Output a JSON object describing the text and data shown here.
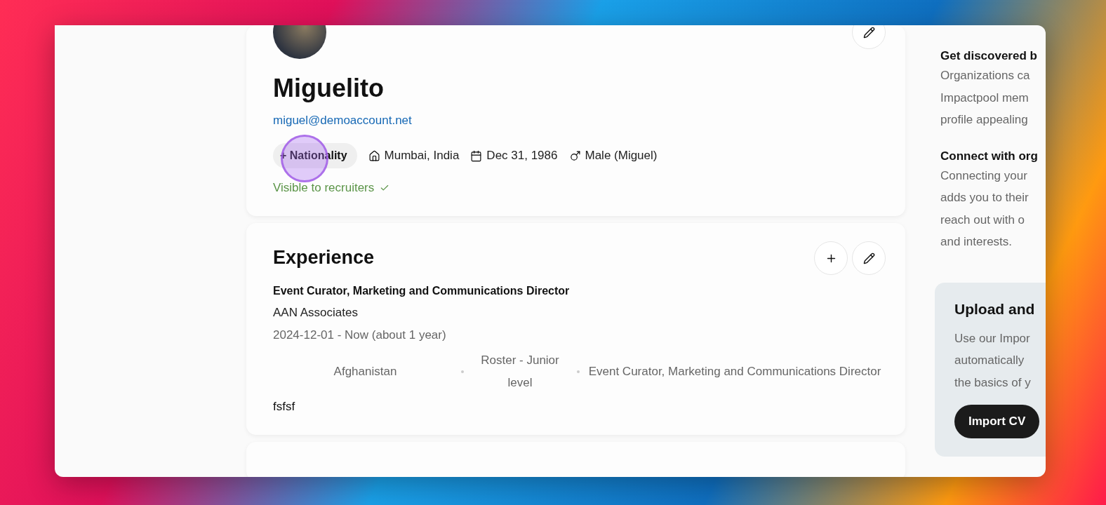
{
  "profile": {
    "name": "Miguelito",
    "email": "miguel@demoaccount.net",
    "nationality_button": "+ Nationality",
    "details": [
      {
        "kind": "location",
        "text": "Mumbai, India"
      },
      {
        "kind": "birthday",
        "text": "Dec 31, 1986"
      },
      {
        "kind": "gender",
        "text": "Male (Miguel)"
      }
    ],
    "visibility": {
      "text": "Visible to recruiters",
      "checked": true
    }
  },
  "experience": {
    "title": "Experience",
    "entries": [
      {
        "position": "Event Curator, Marketing and Communications Director",
        "organization": "AAN Associates",
        "dates": "2024-12-01 - Now (about 1 year)",
        "meta": [
          "Afghanistan",
          "Roster - Junior level",
          "Event Curator, Marketing and Communications Director"
        ],
        "description": "fsfsf"
      }
    ]
  },
  "sidebar": {
    "sections": [
      {
        "title": "Get discovered b",
        "lines": [
          "Organizations ca",
          "Impactpool mem",
          "profile appealing"
        ]
      },
      {
        "title": "Connect with org",
        "lines": [
          "Connecting your",
          "adds you to their",
          "reach out with o",
          "and interests."
        ]
      }
    ],
    "upload": {
      "title": "Upload and",
      "lines": [
        "Use our Impor",
        "automatically",
        "the basics of y"
      ],
      "button": "Import CV"
    }
  }
}
